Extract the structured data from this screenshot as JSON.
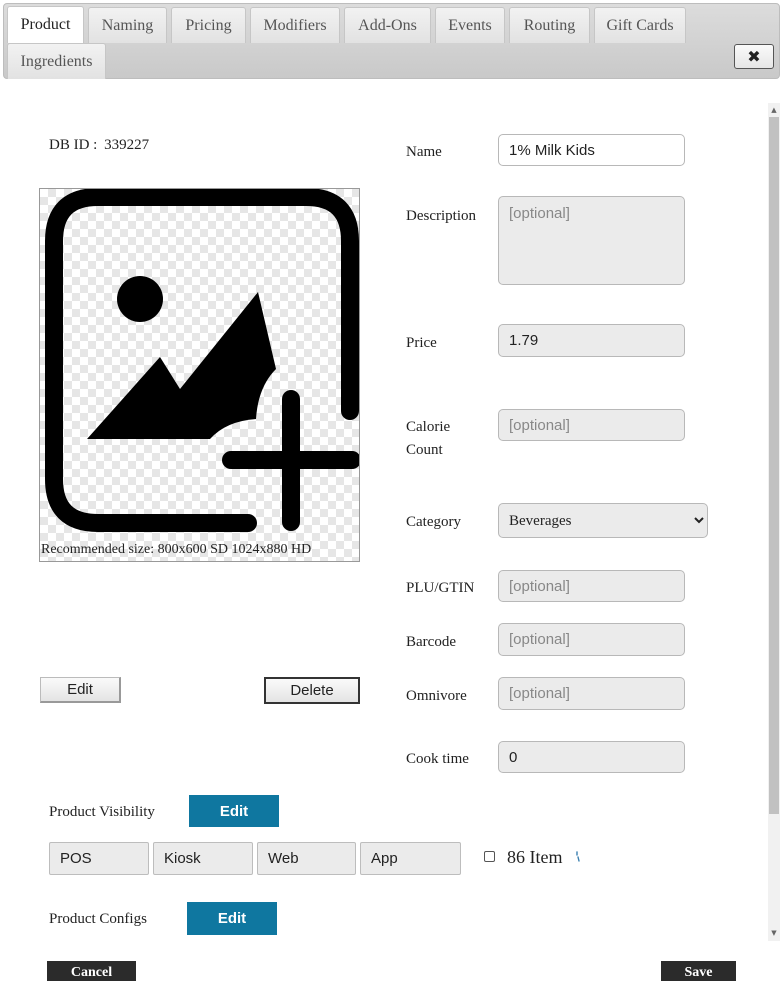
{
  "tabs": [
    {
      "label": "Product",
      "active": true
    },
    {
      "label": "Naming"
    },
    {
      "label": "Pricing"
    },
    {
      "label": "Modifiers"
    },
    {
      "label": "Add-Ons"
    },
    {
      "label": "Events"
    },
    {
      "label": "Routing"
    },
    {
      "label": "Gift Cards"
    },
    {
      "label": "Ingredients"
    }
  ],
  "close_glyph": "✖",
  "db_id": {
    "label": "DB ID :",
    "value": "339227"
  },
  "image": {
    "icon": "image-add-icon",
    "caption": "Recommended size: 800x600 SD 1024x880 HD",
    "edit_label": "Edit",
    "delete_label": "Delete"
  },
  "form": {
    "name": {
      "label": "Name",
      "value": "1% Milk Kids"
    },
    "description": {
      "label": "Description",
      "placeholder": "[optional]"
    },
    "price": {
      "label": "Price",
      "value": "1.79"
    },
    "calorie": {
      "label_line1": "Calorie",
      "label_line2": "Count",
      "placeholder": "[optional]"
    },
    "category": {
      "label": "Category",
      "selected": "Beverages"
    },
    "plu": {
      "label": "PLU/GTIN",
      "placeholder": "[optional]"
    },
    "barcode": {
      "label": "Barcode",
      "placeholder": "[optional]"
    },
    "omnivore": {
      "label": "Omnivore",
      "placeholder": "[optional]"
    },
    "cook_time": {
      "label": "Cook time",
      "value": "0"
    }
  },
  "visibility": {
    "label": "Product Visibility",
    "edit_label": "Edit",
    "channels": [
      "POS",
      "Kiosk",
      "Web",
      "App"
    ],
    "eighty_six_label": "86 Item"
  },
  "configs": {
    "label": "Product Configs",
    "edit_label": "Edit"
  },
  "footer": {
    "cancel_label": "Cancel",
    "save_label": "Save"
  },
  "colors": {
    "accent": "#0f77a0",
    "dark_button": "#2b2b2b"
  }
}
